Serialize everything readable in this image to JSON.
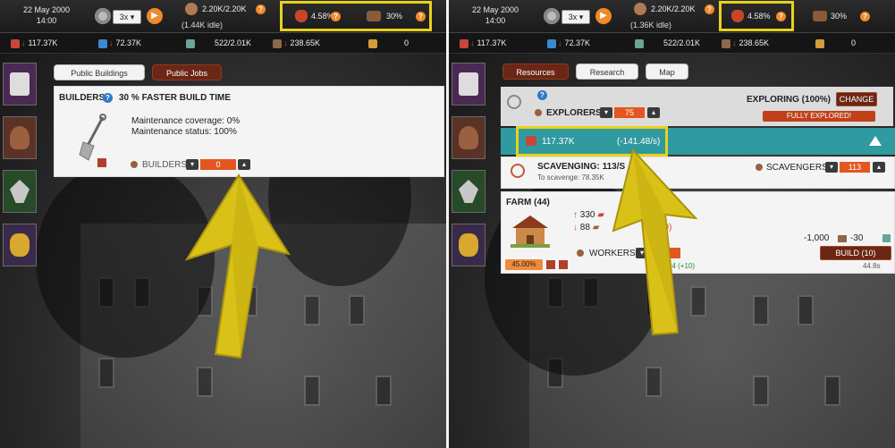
{
  "top": {
    "date": "22 May 2000",
    "time": "14:00",
    "speed": "3x",
    "population": "2.20K/2.20K",
    "idle_left": "(1.44K idle)",
    "idle_right": "(1.36K idle)",
    "morale": "4.58%",
    "food_ratio": "30%"
  },
  "resources": {
    "meat": "117.37K",
    "water": "72.37K",
    "cloth": "522/2.01K",
    "wood": "238.65K",
    "fuel": "0"
  },
  "left_panel": {
    "tabs": [
      "Public Buildings",
      "Public Jobs"
    ],
    "builders_title": "BUILDERS",
    "builders_bonus": "30 % FASTER BUILD TIME",
    "coverage": "Maintenance coverage: 0%",
    "status": "Maintenance status: 100%",
    "builders_label": "BUILDERS",
    "builders_value": "0"
  },
  "right_panel": {
    "tabs": [
      "Resources",
      "Research",
      "Map"
    ],
    "exploring": "EXPLORING (100%)",
    "change": "CHANGE",
    "explorers_label": "EXPLORERS",
    "explorers_value": "75",
    "fully_explored": "FULLY EXPLORED!",
    "meat_amount": "117.37K",
    "meat_rate": "(-141.48/s)",
    "scavenging": "SCAVENGING: 113/S",
    "to_scavenge": "To scavenge: 78.35K",
    "scavengers_label": "SCAVENGERS:",
    "scavengers_value": "113",
    "farm_title": "FARM (44)",
    "farm_stat1": "330",
    "farm_stat2": "88",
    "farm_stat2_tail": "10)",
    "workers_label": "WORKERS:",
    "workers_value": "4",
    "workers_count": "44 (+10)",
    "farm_percent": "45.00%",
    "cost_wood": "-1,000",
    "cost_other": "-30",
    "build": "BUILD (10)",
    "build_time": "44.8s"
  },
  "colors": {
    "highlight": "#e8d21a",
    "accent_orange": "#e3561f",
    "dark_red": "#6b2614",
    "teal": "#2f9aa0"
  }
}
